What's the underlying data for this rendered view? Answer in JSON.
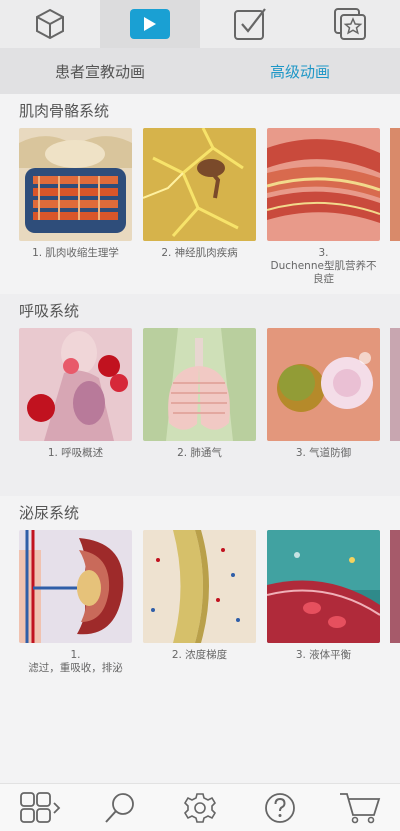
{
  "top_tabs": [
    {
      "icon": "cube-icon"
    },
    {
      "icon": "play-icon",
      "active": true
    },
    {
      "icon": "checkbox-icon"
    },
    {
      "icon": "star-icon"
    }
  ],
  "sub_tabs": [
    {
      "label": "患者宣教动画"
    },
    {
      "label": "高级动画",
      "active": true
    }
  ],
  "sections": [
    {
      "title": "肌肉骨骼系统",
      "items": [
        {
          "caption": "1.  肌肉收缩生理学"
        },
        {
          "caption": "2.  神经肌肉疾病"
        },
        {
          "caption": "3.\nDuchenne型肌营养不良症"
        }
      ]
    },
    {
      "title": "呼吸系统",
      "items": [
        {
          "caption": "1.  呼吸概述"
        },
        {
          "caption": "2.  肺通气"
        },
        {
          "caption": "3.  气道防御"
        }
      ]
    },
    {
      "title": "泌尿系统",
      "items": [
        {
          "caption": "1.\n滤过，重吸收，排泌"
        },
        {
          "caption": "2.  浓度梯度"
        },
        {
          "caption": "3.  液体平衡"
        }
      ]
    }
  ],
  "bottom_nav": [
    {
      "icon": "grid-menu-icon"
    },
    {
      "icon": "search-icon"
    },
    {
      "icon": "settings-gear-icon"
    },
    {
      "icon": "help-icon"
    },
    {
      "icon": "cart-icon"
    }
  ],
  "colors": {
    "accent": "#1aa0d3",
    "active_text": "#1e97c7"
  }
}
